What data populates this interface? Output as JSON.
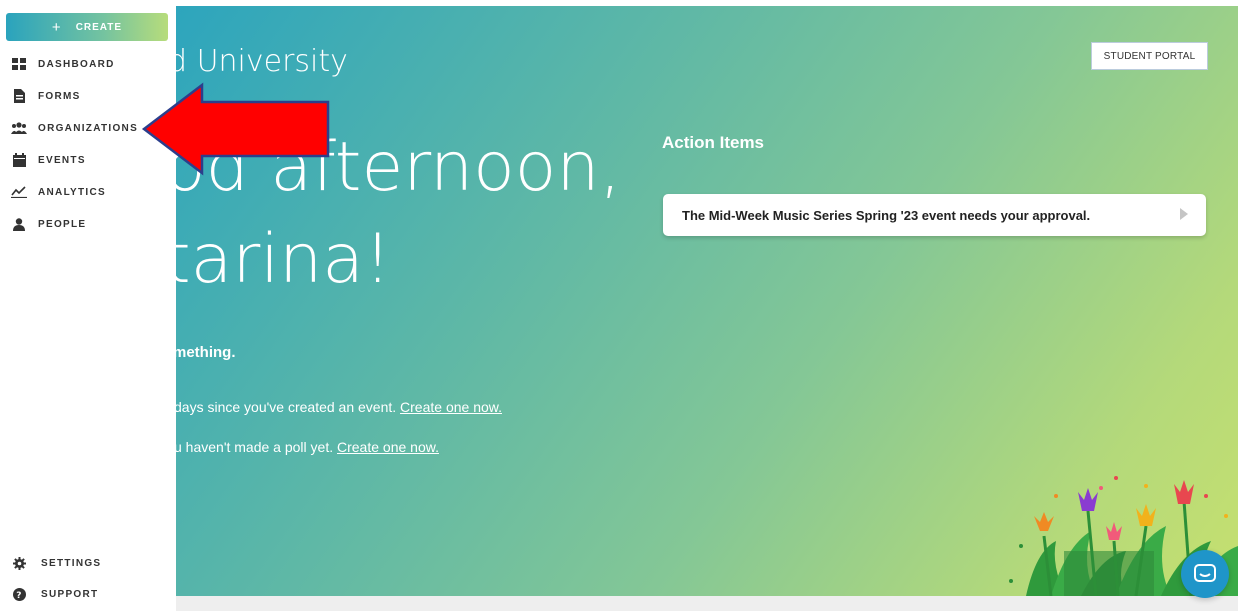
{
  "sidebar": {
    "create_label": "CREATE",
    "items": [
      {
        "label": "DASHBOARD",
        "icon": "dashboard-icon"
      },
      {
        "label": "FORMS",
        "icon": "forms-icon"
      },
      {
        "label": "ORGANIZATIONS",
        "icon": "organizations-icon"
      },
      {
        "label": "EVENTS",
        "icon": "events-icon"
      },
      {
        "label": "ANALYTICS",
        "icon": "analytics-icon"
      },
      {
        "label": "PEOPLE",
        "icon": "people-icon"
      }
    ],
    "bottom_items": [
      {
        "label": "SETTINGS",
        "icon": "gear-icon"
      },
      {
        "label": "SUPPORT",
        "icon": "question-icon"
      }
    ]
  },
  "header": {
    "university_title": "d University",
    "portal_button": "STUDENT PORTAL"
  },
  "greeting": {
    "line1": "od afternoon,",
    "line2": "tarina!"
  },
  "suggestions": {
    "heading": "mething.",
    "event_text": "days since you've created an event. ",
    "event_link": "Create one now.",
    "poll_text": "u haven't made a poll yet. ",
    "poll_link": "Create one now."
  },
  "action_items": {
    "title": "Action Items",
    "items": [
      {
        "text": "The Mid-Week Music Series Spring '23 event needs your approval."
      }
    ]
  },
  "colors": {
    "accent": "#2aa3bd",
    "gradient_end": "#c6e06f",
    "annotation_arrow": "#ff0000",
    "chat": "#1f95c9"
  }
}
